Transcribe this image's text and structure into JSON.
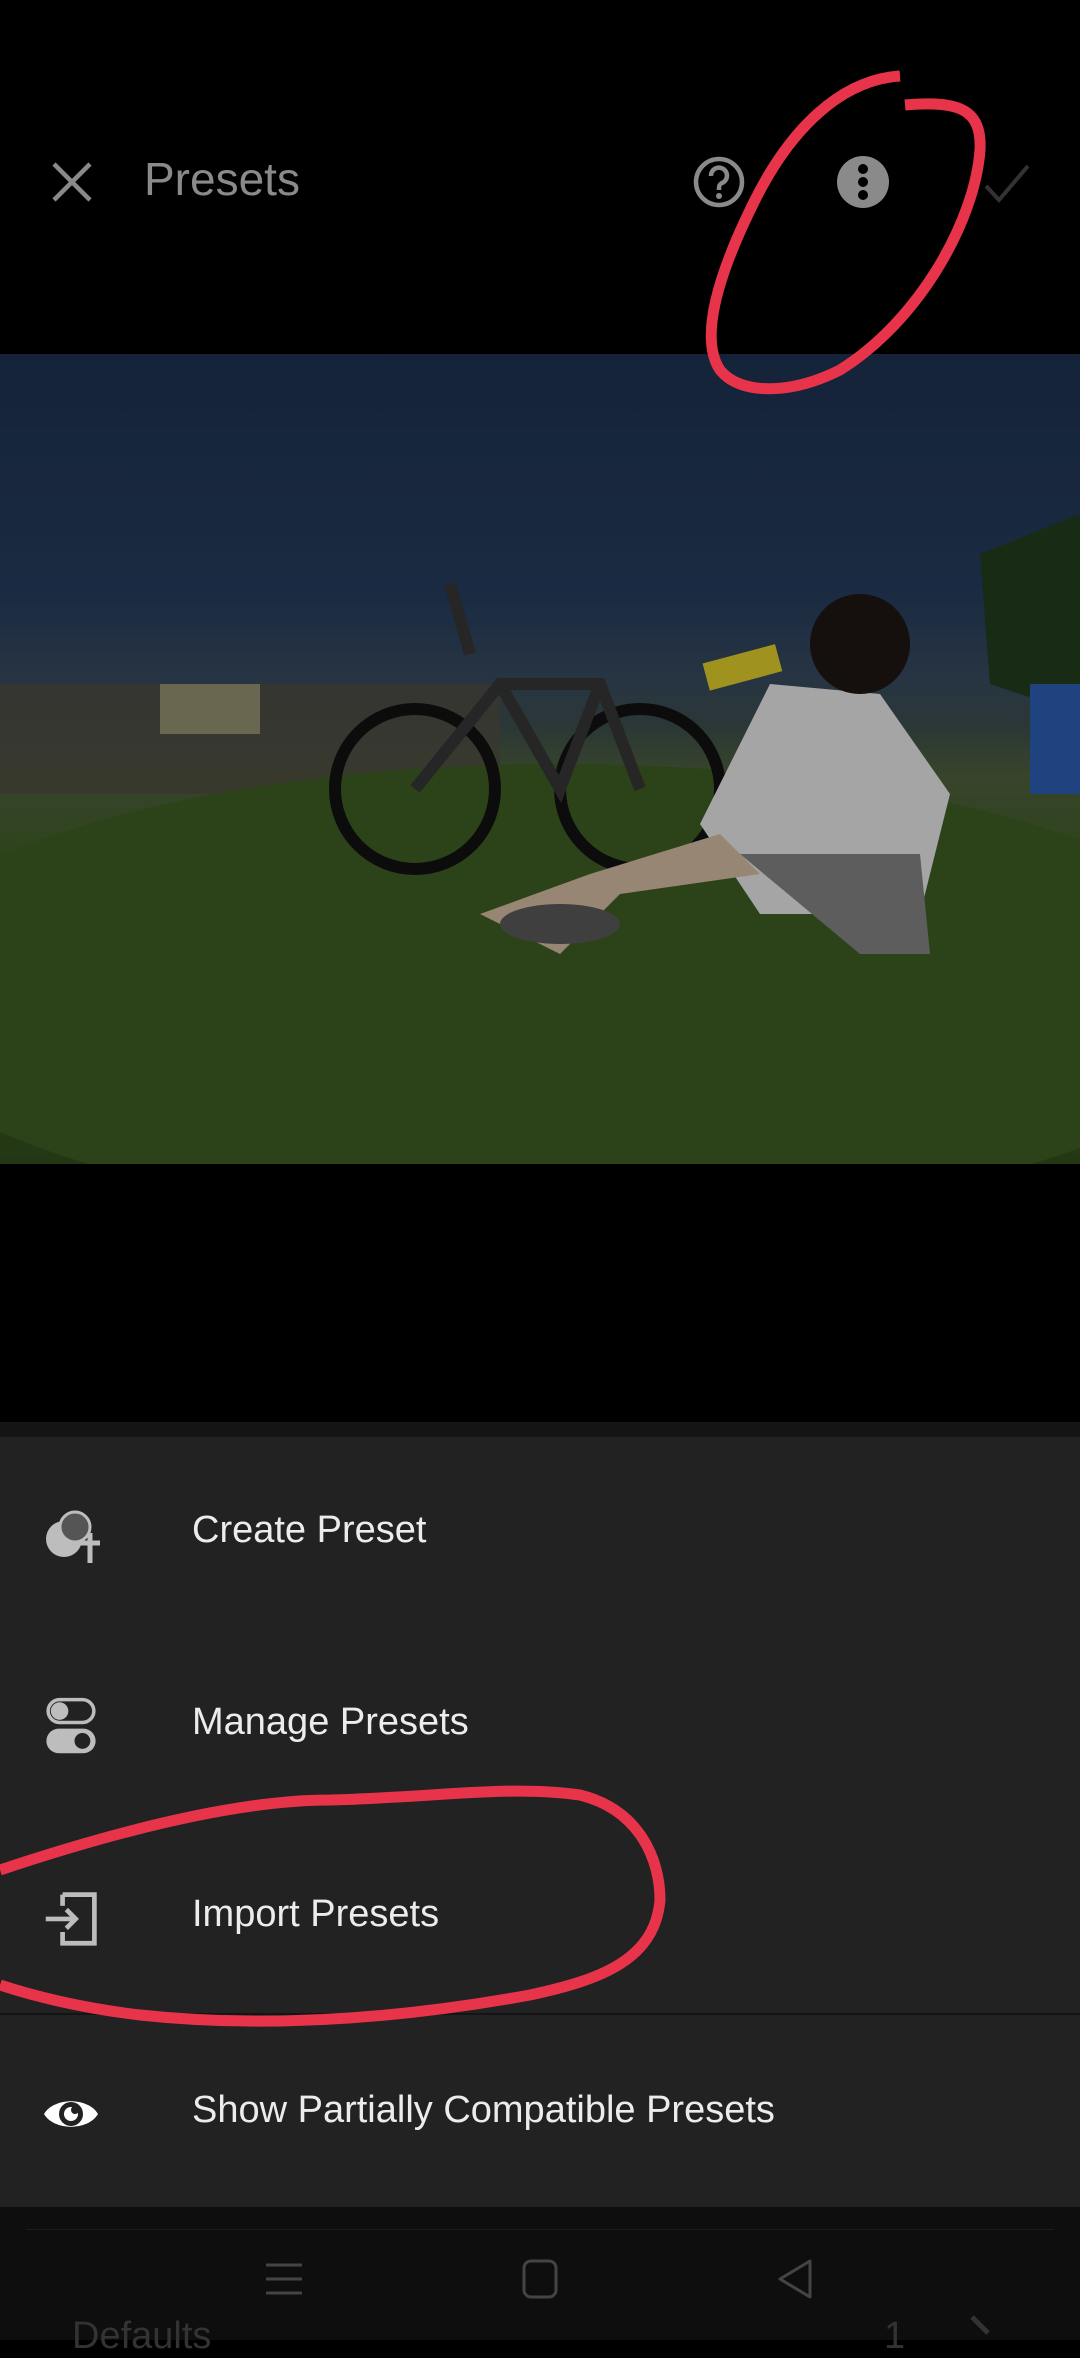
{
  "header": {
    "title": "Presets",
    "icons": [
      "close-icon",
      "help-icon",
      "more-vertical-icon",
      "checkmark-icon"
    ]
  },
  "menu": {
    "items": [
      {
        "label": "Create Preset",
        "icon": "create-preset-icon"
      },
      {
        "label": "Manage Presets",
        "icon": "toggle-switches-icon"
      },
      {
        "label": "Import Presets",
        "icon": "import-icon"
      },
      {
        "label": "Show Partially Compatible Presets",
        "icon": "eye-icon"
      }
    ]
  },
  "behind_sheet": {
    "group_label": "Defaults",
    "count": "1"
  },
  "system_nav": [
    "recents-icon",
    "home-icon",
    "back-icon"
  ],
  "colors": {
    "annotation": "#e8344a",
    "menu_bg": "#222222",
    "header_text": "#8a8a8a"
  }
}
